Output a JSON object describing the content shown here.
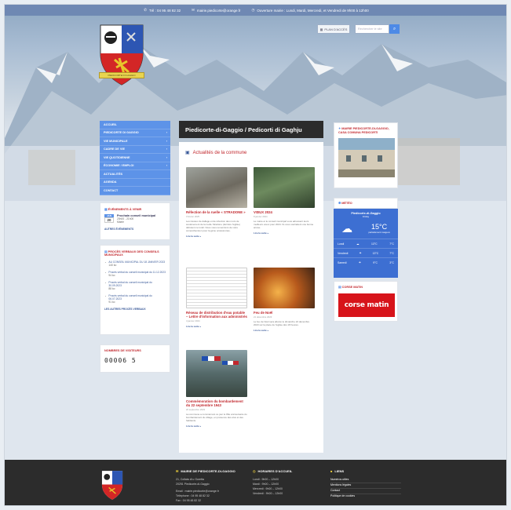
{
  "topbar": {
    "phone": "Tél : 04 95 48 82 32",
    "email": "mairie.piedicorte@orange.fr",
    "hours": "Ouverture mairie : Lundi, Mardi, Mercredi, et Vendredi de 9h00 à 12h00"
  },
  "header": {
    "crest_motto": "PIEDICORTE DI GAGGIO",
    "plan_label": "PLAN D'ACCÈS",
    "search_placeholder": "Rechercher le site"
  },
  "nav": {
    "items": [
      {
        "label": "ACCUEIL",
        "arrow": ""
      },
      {
        "label": "PIEDICORTE DI GAGGIO",
        "arrow": "›"
      },
      {
        "label": "VIE MUNICIPALE",
        "arrow": "›"
      },
      {
        "label": "CADRE DE VIE",
        "arrow": "›"
      },
      {
        "label": "VIE QUOTIDIENNE",
        "arrow": "›"
      },
      {
        "label": "ÉCONOMIE / EMPLOI",
        "arrow": "›"
      },
      {
        "label": "ACTUALITÉS",
        "arrow": ""
      },
      {
        "label": "AGENDA",
        "arrow": ""
      },
      {
        "label": "CONTACT",
        "arrow": ""
      }
    ]
  },
  "events": {
    "title": "ÉVÉNEMENTS À VENIR",
    "month": "JAN",
    "day": "20",
    "event_title": "Prochain conseil municipal",
    "event_time": "20h00 - 21h00",
    "event_place": "Mairie",
    "all_link": "AUTRES ÉVÉNEMENTS"
  },
  "minutes": {
    "title": "PROCÈS VERBAUX DES CONSEILS MUNICIPAUX",
    "items": [
      {
        "label": "AU CONSEIL MUNICIPAL DU 18 JANVIER 2023",
        "size": "140 ko"
      },
      {
        "label": "Procès verbal du conseil municipal du 11.12.2023",
        "size": "94 ko"
      },
      {
        "label": "Procès verbal du conseil municipal du 30.09.2023",
        "size": "88 ko"
      },
      {
        "label": "Procès verbal du conseil municipal du 06.07.2023",
        "size": "91 ko"
      }
    ],
    "all_link": "LES AUTRES PROCÈS VERBAUX"
  },
  "visitors": {
    "title": "NOMBRES DE VISITEURS",
    "count": "00006 5"
  },
  "main": {
    "title": "Piedicorte-di-Gaggio / Pedicorti di Gaghju",
    "news_heading": "Actualités de la commune",
    "read_more": "Lire la suite »",
    "news": [
      {
        "title": "Réfection de la ruelle « STRADONE »",
        "date": "3 février 2025",
        "text": "Les travaux de dallage et de réfection des murs de soutènement de la ruelle Stradone (derrière l'église) débutent ce lundi. Nous vous remercions de votre compréhension pour la gêne occasionnée."
      },
      {
        "title": "VŒUX 2024",
        "date": "8 janvier 2024",
        "text": "Le maire et le conseil municipal vous adressent leurs meilleurs vœux pour 2024. Ils vous souhaitent une bonne année."
      },
      {
        "title": "Réseau de distribution d'eau potable – Lettre d'information aux administrés",
        "date": "4 janvier 2024",
        "text": ""
      },
      {
        "title": "Feu de Noël",
        "date": "21 décembre 2023",
        "text": "Le feu de Noël sera allumé le dimanche 24 décembre 2023 sur la place de l'église dès 18 heures."
      },
      {
        "title": "Commémoration du bombardement du 22 septembre 1943",
        "date": "22 septembre 2023",
        "text": "La commune a commémoré ce jour le 80e anniversaire du bombardement du village, en présence des élus et des habitants."
      }
    ]
  },
  "right": {
    "mairie_title": "MAIRIE PIEDICORTE-DI-GAGGIO, CASA COMUNA PEDICORTI",
    "weather_title": "MÉTÉO",
    "weather_place": "Piedicorte-di-Gaggio",
    "weather_day": "Friday",
    "weather_temp": "15°C",
    "weather_desc": "partiellement nuageux",
    "forecast": [
      {
        "day": "Lundi",
        "hi": "13°C",
        "lo": "7°C"
      },
      {
        "day": "Vendredi",
        "hi": "13°C",
        "lo": "7°C"
      },
      {
        "day": "Samedi",
        "hi": "9°C",
        "lo": "3°C"
      }
    ],
    "corse_title": "CORSE MATIN",
    "corse_logo": "corse matin"
  },
  "footer": {
    "mairie_title": "MAIRIE DE PIEDICORTE-DI-GAGGIO",
    "address1": "21, Collata di u Guretta",
    "address2": "20251 Piedicorte-di-Gaggio",
    "email": "Email : mairie.piedicorte@orange.fr",
    "phone": "Téléphone : 04 95 48 82 32",
    "fax": "Fax : 04 95 48 82 32",
    "hours_title": "HORAIRES D'ACCUEIL",
    "hours": [
      "Lundi : 9h00 – 12h00",
      "Mardi : 9h00 – 12h00",
      "Mercredi : 9h00 – 12h00",
      "Vendredi : 9h00 – 12h00"
    ],
    "links_title": "LIENS",
    "links": [
      "Numéros utiles",
      "Mentions légales",
      "Contact",
      "Politique de cookies"
    ]
  }
}
